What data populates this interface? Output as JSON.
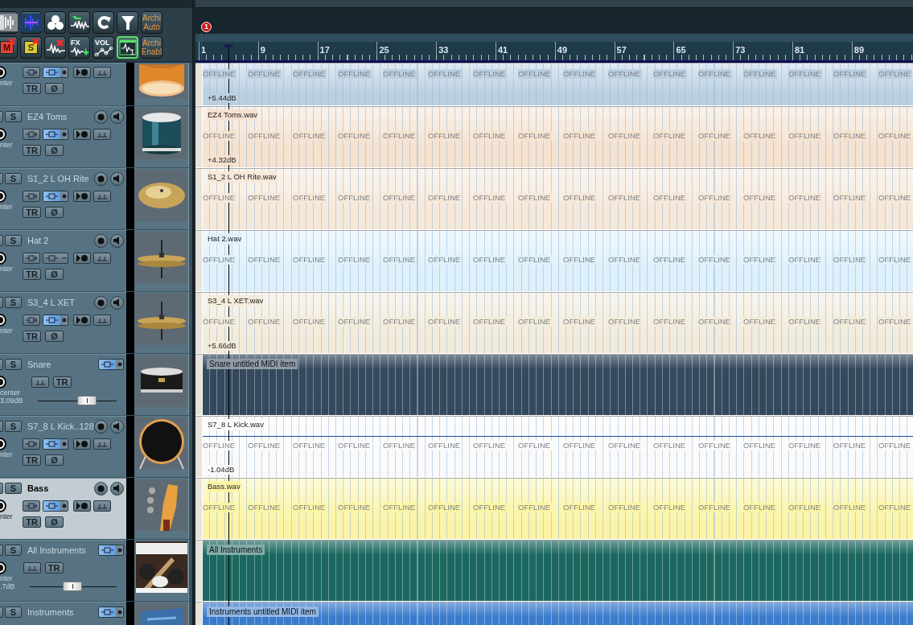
{
  "toolbar": [
    {
      "selected": false
    },
    {
      "selected": false
    },
    {
      "selected": false
    },
    {
      "selected": false
    },
    {
      "selected": false
    },
    {
      "selected": false
    },
    {
      "label": "Archi Auto",
      "selected": false
    },
    {
      "label": "M",
      "selected": false
    },
    {
      "label": "S",
      "selected": false
    },
    {
      "selected": false
    },
    {
      "label": "FX",
      "selected": false
    },
    {
      "label": "VOL",
      "selected": false
    },
    {
      "badge": "1",
      "selected": true
    },
    {
      "label": "Archi Enabl",
      "selected": false
    }
  ],
  "tracks": [
    {
      "kind": "audio",
      "selected": false,
      "monitor_on": true,
      "pan_label": "nter",
      "tr_label": "TR",
      "phase_label": "Ø"
    },
    {
      "kind": "audio",
      "name": "EZ4 Toms",
      "solo_label": "S",
      "selected": false,
      "monitor_on": true,
      "pan_label": "nter",
      "tr_label": "TR",
      "phase_label": "Ø"
    },
    {
      "kind": "audio",
      "name": "S1_2 L OH Rite",
      "solo_label": "S",
      "selected": false,
      "monitor_on": true,
      "pan_label": "nter",
      "tr_label": "TR",
      "phase_label": "Ø"
    },
    {
      "kind": "audio",
      "name": "Hat 2",
      "solo_label": "S",
      "selected": false,
      "monitor_on": false,
      "pan_label": "nter",
      "tr_label": "TR",
      "phase_label": "Ø"
    },
    {
      "kind": "audio",
      "name": "S3_4 L XET",
      "solo_label": "S",
      "selected": false,
      "monitor_on": true,
      "pan_label": "nter",
      "tr_label": "TR",
      "phase_label": "Ø"
    },
    {
      "kind": "folder",
      "name": "Snare",
      "solo_label": "S",
      "selected": false,
      "monitor_on": true,
      "pan_label": "center",
      "volume_label": "3.09dB",
      "level": 0.67,
      "tr_label": "TR"
    },
    {
      "kind": "audio",
      "name": "S7_8 L Kick..128",
      "solo_label": "S",
      "selected": false,
      "monitor_on": true,
      "pan_label": "nter",
      "tr_label": "TR",
      "phase_label": "Ø"
    },
    {
      "kind": "audio",
      "name": "Bass",
      "solo_label": "S",
      "selected": true,
      "monitor_on": true,
      "pan_label": "nter",
      "tr_label": "TR",
      "phase_label": "Ø"
    },
    {
      "kind": "folder",
      "name": "All Instruments",
      "solo_label": "S",
      "selected": false,
      "monitor_on": true,
      "pan_label": "nter",
      "volume_label": ".7dB",
      "level": 0.49,
      "tr_label": "TR"
    },
    {
      "kind": "folder",
      "name": "Instruments",
      "solo_label": "S",
      "selected": false,
      "monitor_on": true
    }
  ],
  "marker": {
    "label": "1"
  },
  "ruler": {
    "labels": [
      "1",
      "9",
      "17",
      "25",
      "33",
      "41",
      "49",
      "57",
      "65",
      "73",
      "81",
      "89"
    ]
  },
  "lanes": [
    {
      "kind": "audio",
      "color": "#bcd0e0",
      "gain": "+5.44dB",
      "offline_labels": [
        "OFFLINE",
        "OFFLINE",
        "OFFLINE",
        "OFFLINE",
        "OFFLINE",
        "OFFLINE",
        "OFFLINE",
        "OFFLINE",
        "OFFLINE",
        "OFFLINE",
        "OFFLINE",
        "OFFLINE",
        "OFFLINE",
        "OFFLINE",
        "OFFLINE",
        "OFFLINE"
      ]
    },
    {
      "kind": "audio",
      "color": "#f5e2cf",
      "clip_name": "EZ4 Toms.wav",
      "gain": "+4.32dB",
      "offline_labels": [
        "OFFLINE",
        "OFFLINE",
        "OFFLINE",
        "OFFLINE",
        "OFFLINE",
        "OFFLINE",
        "OFFLINE",
        "OFFLINE",
        "OFFLINE",
        "OFFLINE",
        "OFFLINE",
        "OFFLINE",
        "OFFLINE",
        "OFFLINE",
        "OFFLINE",
        "OFFLINE"
      ]
    },
    {
      "kind": "audio",
      "color": "#f6e8d8",
      "clip_name": "S1_2 L OH Rite.wav",
      "offline_labels": [
        "OFFLINE",
        "OFFLINE",
        "OFFLINE",
        "OFFLINE",
        "OFFLINE",
        "OFFLINE",
        "OFFLINE",
        "OFFLINE",
        "OFFLINE",
        "OFFLINE",
        "OFFLINE",
        "OFFLINE",
        "OFFLINE",
        "OFFLINE",
        "OFFLINE",
        "OFFLINE"
      ]
    },
    {
      "kind": "audio",
      "color": "#def0fa",
      "clip_name": "Hat 2.wav",
      "offline_labels": [
        "OFFLINE",
        "OFFLINE",
        "OFFLINE",
        "OFFLINE",
        "OFFLINE",
        "OFFLINE",
        "OFFLINE",
        "OFFLINE",
        "OFFLINE",
        "OFFLINE",
        "OFFLINE",
        "OFFLINE",
        "OFFLINE",
        "OFFLINE",
        "OFFLINE",
        "OFFLINE"
      ]
    },
    {
      "kind": "audio",
      "color": "#f3ebda",
      "clip_name": "S3_4 L XET.wav",
      "gain": "+5.66dB",
      "offline_labels": [
        "OFFLINE",
        "OFFLINE",
        "OFFLINE",
        "OFFLINE",
        "OFFLINE",
        "OFFLINE",
        "OFFLINE",
        "OFFLINE",
        "OFFLINE",
        "OFFLINE",
        "OFFLINE",
        "OFFLINE",
        "OFFLINE",
        "OFFLINE",
        "OFFLINE",
        "OFFLINE"
      ]
    },
    {
      "kind": "midi",
      "color": "#34495d",
      "clip_name": "Snare untitled MIDI item"
    },
    {
      "kind": "audio",
      "color": "#fafafa",
      "clip_name": "S7_8 L Kick.wav",
      "gain": "-1.04dB",
      "envelope": true,
      "offline_labels": [
        "OFFLINE",
        "OFFLINE",
        "OFFLINE",
        "OFFLINE",
        "OFFLINE",
        "OFFLINE",
        "OFFLINE",
        "OFFLINE",
        "OFFLINE",
        "OFFLINE",
        "OFFLINE",
        "OFFLINE",
        "OFFLINE",
        "OFFLINE",
        "OFFLINE",
        "OFFLINE"
      ]
    },
    {
      "kind": "audio",
      "color": "#fbf4a6",
      "clip_name": "Bass.wav",
      "offline_labels": [
        "OFFLINE",
        "OFFLINE",
        "OFFLINE",
        "OFFLINE",
        "OFFLINE",
        "OFFLINE",
        "OFFLINE",
        "OFFLINE",
        "OFFLINE",
        "OFFLINE",
        "OFFLINE",
        "OFFLINE",
        "OFFLINE",
        "OFFLINE",
        "OFFLINE",
        "OFFLINE"
      ]
    },
    {
      "kind": "midi",
      "color": "#1c6860",
      "clip_name": "All Instruments"
    },
    {
      "kind": "midi",
      "color": "#3b7bcc",
      "clip_name": "Instruments untitled MIDI item"
    }
  ]
}
